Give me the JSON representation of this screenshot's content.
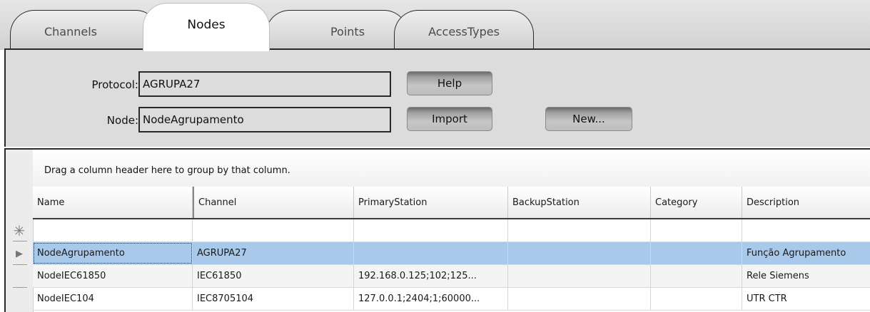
{
  "tabs": [
    {
      "label": "Channels"
    },
    {
      "label": "Nodes"
    },
    {
      "label": "Points"
    },
    {
      "label": "AccessTypes"
    }
  ],
  "form": {
    "protocol_label": "Protocol:",
    "protocol_value": "AGRUPA27",
    "node_label": "Node:",
    "node_value": "NodeAgrupamento",
    "help_button": "Help",
    "import_button": "Import",
    "new_button": "New..."
  },
  "grid": {
    "group_hint": "Drag a column header here to group by that column.",
    "columns": [
      "Name",
      "Channel",
      "PrimaryStation",
      "BackupStation",
      "Category",
      "Description"
    ],
    "new_row_icon": "asterisk-icon",
    "current_row_icon": "triangle-right-icon",
    "rows": [
      [
        "NodeAgrupamento",
        "AGRUPA27",
        "",
        "",
        "",
        "Função Agrupamento"
      ],
      [
        "NodeIEC61850",
        "IEC61850",
        "192.168.0.125;102;125...",
        "",
        "",
        "Rele Siemens"
      ],
      [
        "NodeIEC104",
        "IEC8705104",
        "127.0.0.1;2404;1;60000...",
        "",
        "",
        "UTR CTR"
      ]
    ],
    "selected_row_color": "#a9c9ea"
  }
}
